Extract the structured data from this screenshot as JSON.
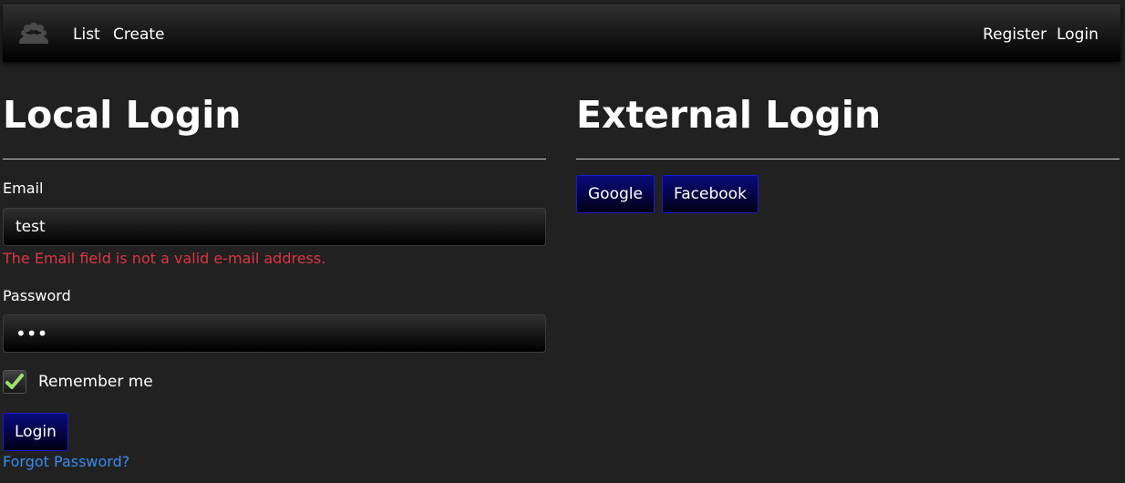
{
  "navbar": {
    "brand_icon": "group-people-icon",
    "left_links": [
      "List",
      "Create"
    ],
    "right_links": [
      "Register",
      "Login"
    ]
  },
  "local_login": {
    "title": "Local Login",
    "email_label": "Email",
    "email_value": "test",
    "email_error": "The Email field is not a valid e-mail address.",
    "password_label": "Password",
    "password_value": "•••",
    "remember_label": "Remember me",
    "remember_checked": true,
    "login_button": "Login",
    "forgot_link": "Forgot Password?"
  },
  "external_login": {
    "title": "External Login",
    "providers": [
      "Google",
      "Facebook"
    ]
  },
  "colors": {
    "background": "#212121",
    "error": "#dc3545",
    "link": "#3b8bf0",
    "button_border": "#1a1acc"
  }
}
